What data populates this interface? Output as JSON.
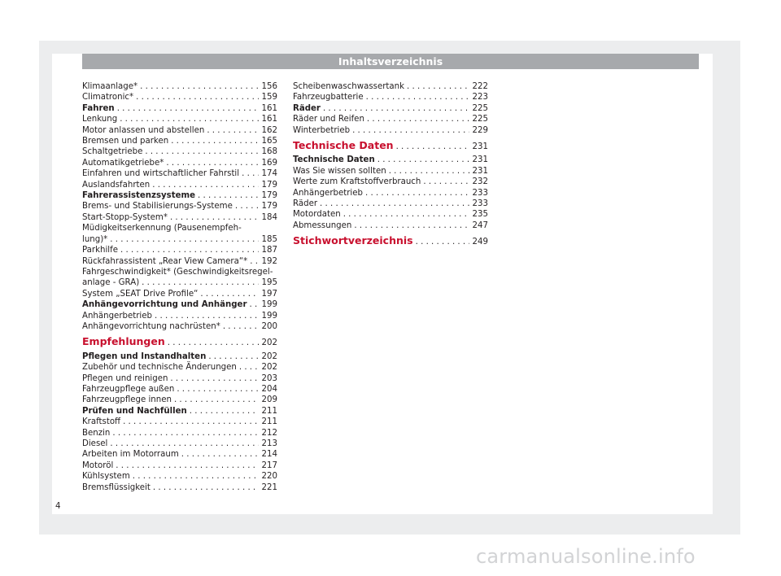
{
  "header": {
    "title": "Inhaltsverzeichnis"
  },
  "columns": [
    {
      "entries": [
        {
          "text": "Klimaanlage*",
          "page": "156",
          "style": "normal"
        },
        {
          "text": "Climatronic*",
          "page": "159",
          "style": "normal"
        },
        {
          "text": "Fahren",
          "page": "161",
          "style": "bold"
        },
        {
          "text": "Lenkung",
          "page": "161",
          "style": "normal"
        },
        {
          "text": "Motor anlassen und abstellen",
          "page": "162",
          "style": "normal"
        },
        {
          "text": "Bremsen und parken",
          "page": "165",
          "style": "normal"
        },
        {
          "text": "Schaltgetriebe",
          "page": "168",
          "style": "normal"
        },
        {
          "text": "Automatikgetriebe*",
          "page": "169",
          "style": "normal"
        },
        {
          "text": "Einfahren und wirtschaftlicher Fahrstil",
          "page": "174",
          "style": "normal"
        },
        {
          "text": "Auslandsfahrten",
          "page": "179",
          "style": "normal"
        },
        {
          "text": "Fahrerassistenzsysteme",
          "page": "179",
          "style": "bold"
        },
        {
          "text": "Brems- und Stabilisierungs-Systeme",
          "page": "179",
          "style": "normal"
        },
        {
          "text": "Start-Stopp-System*",
          "page": "184",
          "style": "normal"
        },
        {
          "pre": "Müdigkeitserkennung (Pausenempfeh-",
          "text": "lung)*",
          "page": "185",
          "style": "normal"
        },
        {
          "text": "Parkhilfe",
          "page": "187",
          "style": "normal"
        },
        {
          "text": "Rückfahrassistent „Rear View Camera“*",
          "page": "192",
          "style": "normal"
        },
        {
          "pre": "Fahrgeschwindigkeit* (Geschwindigkeitsregel-",
          "text": "anlage - GRA)",
          "page": "195",
          "style": "normal"
        },
        {
          "text": "System „SEAT Drive Profile“",
          "page": "197",
          "style": "normal"
        },
        {
          "text": "Anhängevorrichtung und Anhänger",
          "page": "199",
          "style": "bold"
        },
        {
          "text": "Anhängerbetrieb",
          "page": "199",
          "style": "normal"
        },
        {
          "text": "Anhängevorrichtung nachrüsten*",
          "page": "200",
          "style": "normal"
        },
        {
          "text": "Empfehlungen",
          "page": "202",
          "style": "section"
        },
        {
          "text": "Pflegen und Instandhalten",
          "page": "202",
          "style": "bold"
        },
        {
          "text": "Zubehör und technische Änderungen",
          "page": "202",
          "style": "normal"
        },
        {
          "text": "Pflegen und reinigen",
          "page": "203",
          "style": "normal"
        },
        {
          "text": "Fahrzeugpflege außen",
          "page": "204",
          "style": "normal"
        },
        {
          "text": "Fahrzeugpflege innen",
          "page": "209",
          "style": "normal"
        },
        {
          "text": "Prüfen und Nachfüllen",
          "page": "211",
          "style": "bold"
        },
        {
          "text": "Kraftstoff",
          "page": "211",
          "style": "normal"
        },
        {
          "text": "Benzin",
          "page": "212",
          "style": "normal"
        },
        {
          "text": "Diesel",
          "page": "213",
          "style": "normal"
        },
        {
          "text": "Arbeiten im Motorraum",
          "page": "214",
          "style": "normal"
        },
        {
          "text": "Motoröl",
          "page": "217",
          "style": "normal"
        },
        {
          "text": "Kühlsystem",
          "page": "220",
          "style": "normal"
        },
        {
          "text": "Bremsflüssigkeit",
          "page": "221",
          "style": "normal"
        }
      ]
    },
    {
      "entries": [
        {
          "text": "Scheibenwaschwassertank",
          "page": "222",
          "style": "normal"
        },
        {
          "text": "Fahrzeugbatterie",
          "page": "223",
          "style": "normal"
        },
        {
          "text": "Räder",
          "page": "225",
          "style": "bold"
        },
        {
          "text": "Räder und Reifen",
          "page": "225",
          "style": "normal"
        },
        {
          "text": "Winterbetrieb",
          "page": "229",
          "style": "normal"
        },
        {
          "text": "Technische Daten",
          "page": "231",
          "style": "section"
        },
        {
          "text": "Technische Daten",
          "page": "231",
          "style": "bold"
        },
        {
          "text": "Was Sie wissen sollten",
          "page": "231",
          "style": "normal"
        },
        {
          "text": "Werte zum Kraftstoffverbrauch",
          "page": "232",
          "style": "normal"
        },
        {
          "text": "Anhängerbetrieb",
          "page": "233",
          "style": "normal"
        },
        {
          "text": "Räder",
          "page": "233",
          "style": "normal"
        },
        {
          "text": "Motordaten",
          "page": "235",
          "style": "normal"
        },
        {
          "text": "Abmessungen",
          "page": "247",
          "style": "normal"
        },
        {
          "text": "Stichwortverzeichnis",
          "page": "249",
          "style": "section"
        }
      ]
    }
  ],
  "page_number": "4",
  "watermark": "carmanualsonline.info",
  "colors": {
    "header_bar": "#a7a9ac",
    "section_red": "#c8102e",
    "frame": "#ecedee",
    "text": "#231f20"
  }
}
